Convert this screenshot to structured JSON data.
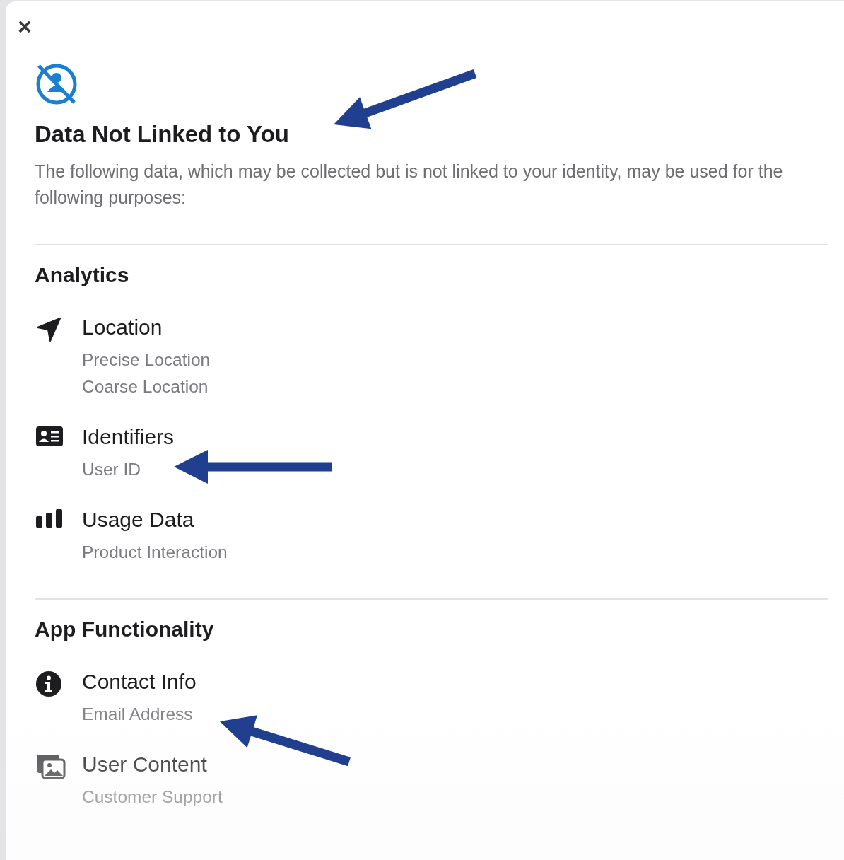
{
  "close_button": "×",
  "title": "Data Not Linked to You",
  "description": "The following data, which may be collected but is not linked to your identity, may be used for the following purposes:",
  "sections": [
    {
      "title": "Analytics",
      "items": [
        {
          "kind": "location",
          "title": "Location",
          "details": [
            "Precise Location",
            "Coarse Location"
          ]
        },
        {
          "kind": "identifiers",
          "title": "Identifiers",
          "details": [
            "User ID"
          ]
        },
        {
          "kind": "usage",
          "title": "Usage Data",
          "details": [
            "Product Interaction"
          ]
        }
      ]
    },
    {
      "title": "App Functionality",
      "items": [
        {
          "kind": "contact",
          "title": "Contact Info",
          "details": [
            "Email Address"
          ]
        },
        {
          "kind": "content",
          "title": "User Content",
          "details": [
            "Customer Support"
          ]
        }
      ]
    }
  ]
}
